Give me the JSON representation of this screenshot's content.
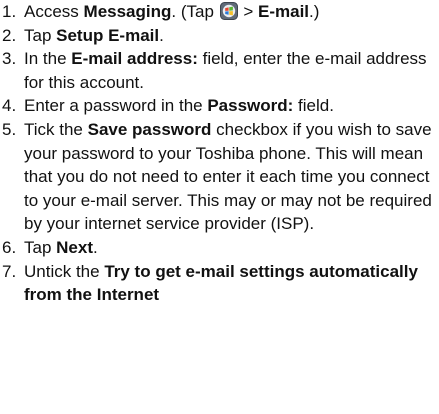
{
  "steps": [
    {
      "num": "1.",
      "parts": [
        {
          "t": "Access "
        },
        {
          "t": "Messaging",
          "b": true
        },
        {
          "t": ". (Tap "
        },
        {
          "icon": "windows-start-icon"
        },
        {
          "t": " > "
        },
        {
          "t": "E-mail",
          "b": true
        },
        {
          "t": ".)"
        }
      ]
    },
    {
      "num": "2.",
      "parts": [
        {
          "t": "Tap "
        },
        {
          "t": "Setup E-mail",
          "b": true
        },
        {
          "t": "."
        }
      ]
    },
    {
      "num": "3.",
      "parts": [
        {
          "t": "In the "
        },
        {
          "t": "E-mail address:",
          "b": true
        },
        {
          "t": " field, enter the e-mail address for this account."
        }
      ]
    },
    {
      "num": "4.",
      "parts": [
        {
          "t": "Enter a password in the "
        },
        {
          "t": "Password:",
          "b": true
        },
        {
          "t": " field."
        }
      ]
    },
    {
      "num": "5.",
      "parts": [
        {
          "t": "Tick the "
        },
        {
          "t": "Save password",
          "b": true
        },
        {
          "t": " checkbox if you wish to save your password to your Toshiba phone. This will mean that you do not need to enter it each time you connect to your e-mail server. This may or may not be required by your internet service provider (ISP)."
        }
      ]
    },
    {
      "num": "6.",
      "parts": [
        {
          "t": "Tap "
        },
        {
          "t": "Next",
          "b": true
        },
        {
          "t": "."
        }
      ]
    },
    {
      "num": "7.",
      "parts": [
        {
          "t": "Untick the "
        },
        {
          "t": "Try to get e-mail settings automatically from the Internet",
          "b": true
        }
      ]
    }
  ]
}
